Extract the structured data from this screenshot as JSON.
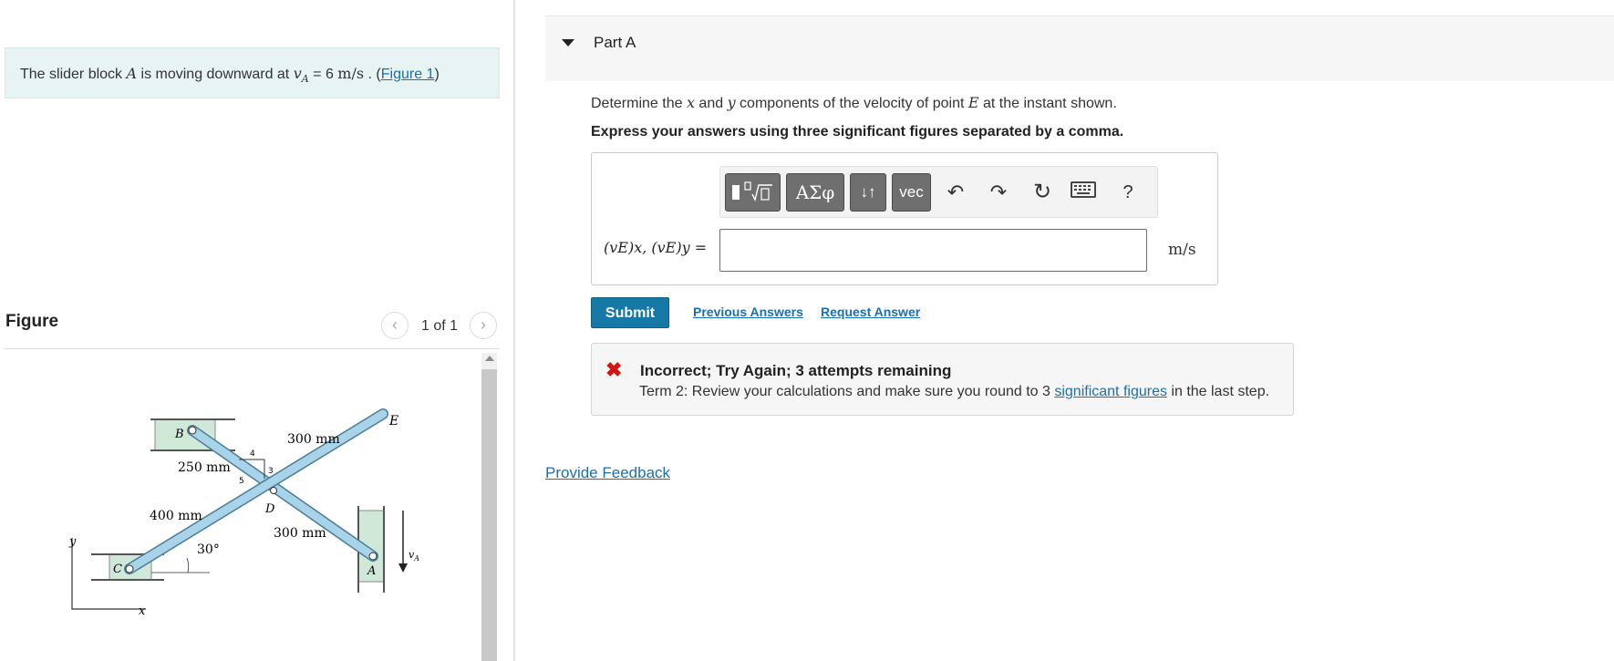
{
  "problem": {
    "text_prefix": "The slider block ",
    "var_A": "A",
    "text_middle": " is moving downward at ",
    "velocity_symbol": "v",
    "velocity_sub": "A",
    "equals": " = 6 ",
    "unit": "m/s",
    "text_suffix": " . (",
    "figure_link": "Figure 1",
    "close_paren": ")"
  },
  "figure_panel": {
    "label": "Figure",
    "counter": "1 of 1",
    "prev_icon": "chevron-left-icon",
    "next_icon": "chevron-right-icon",
    "diagram": {
      "B": "B",
      "C": "C",
      "D": "D",
      "E": "E",
      "A": "A",
      "y": "y",
      "x": "x",
      "vA": "v",
      "vA_sub": "A",
      "dim_300_top": "300 mm",
      "dim_250": "250 mm",
      "dim_400": "400 mm",
      "dim_300_bottom": "300 mm",
      "angle": "30°",
      "slope_4": "4",
      "slope_3": "3",
      "slope_5": "5"
    }
  },
  "part": {
    "title": "Part A",
    "question_prefix": "Determine the ",
    "q_x": "x",
    "q_and": " and ",
    "q_y": "y",
    "question_middle": " components of the velocity of point ",
    "q_E": "E",
    "question_suffix": " at the instant shown.",
    "instruction": "Express your answers using three significant figures separated by a comma."
  },
  "toolbar": {
    "templates_icon": "templates-icon",
    "greek_label": "ΑΣφ",
    "sort_label": "↓↑",
    "vec_label": "vec",
    "undo_icon": "undo-icon",
    "redo_icon": "redo-icon",
    "reset_icon": "reset-icon",
    "keyboard_icon": "keyboard-icon",
    "help_label": "?"
  },
  "answer": {
    "label": "(vE)x, (vE)y =",
    "value": "",
    "unit": "m/s"
  },
  "actions": {
    "submit": "Submit",
    "previous_answers": "Previous Answers",
    "request_answer": "Request Answer"
  },
  "feedback": {
    "title": "Incorrect; Try Again; 3 attempts remaining",
    "text_prefix": "Term 2: Review your calculations and make sure you round to 3 ",
    "link": "significant figures",
    "text_suffix": " in the last step."
  },
  "footer": {
    "provide_feedback": "Provide Feedback"
  },
  "colors": {
    "accent": "#1679a5",
    "link": "#1a6fb0",
    "error": "#d41515",
    "problem_bg": "#e8f4f4",
    "link_member": "#a8d3e8"
  }
}
